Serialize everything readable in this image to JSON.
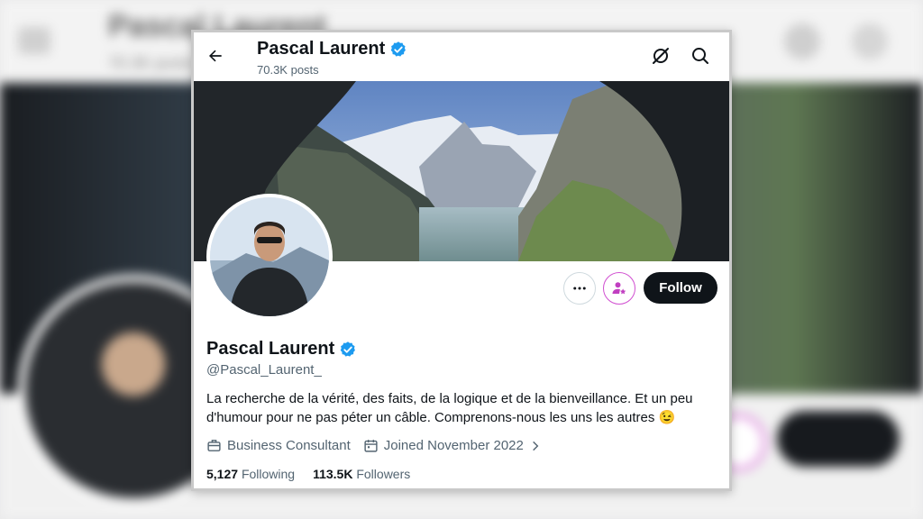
{
  "profile": {
    "name": "Pascal Laurent",
    "posts": "70.3K posts",
    "handle": "@Pascal_Laurent_",
    "bio": "La recherche de la vérité, des faits, de la logique et de la bienveillance. Et un peu d'humour pour ne pas péter un câble. Comprenons-nous les uns les autres",
    "bio_emoji": "😉",
    "profession": "Business Consultant",
    "joined": "Joined November 2022",
    "following_count": "5,127",
    "following_label": "Following",
    "followers_count": "113.5K",
    "followers_label": "Followers"
  },
  "actions": {
    "follow_label": "Follow",
    "more_icon": "more-horizontal-icon",
    "subscribe_icon": "subscribe-star-person-icon"
  },
  "colors": {
    "verified": "#1d9bf0",
    "follow_bg": "#0f1419",
    "subscribe_accent": "#d14fd1",
    "secondary_text": "#536471"
  }
}
